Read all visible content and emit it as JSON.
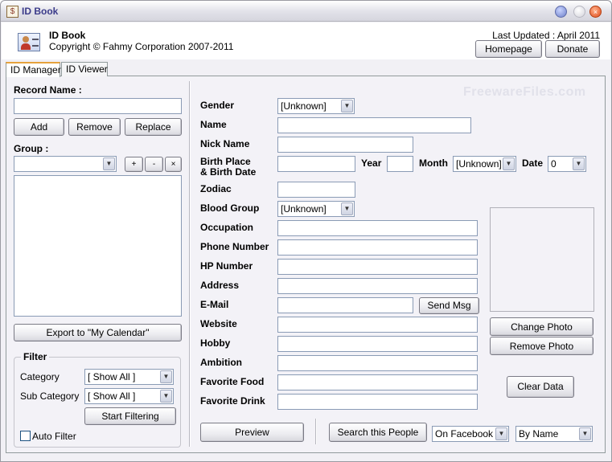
{
  "window": {
    "title": "ID Book"
  },
  "header": {
    "app_name": "ID Book",
    "copyright": "Copyright © Fahmy Corporation 2007-2011",
    "last_updated": "Last Updated : April 2011",
    "homepage_label": "Homepage",
    "donate_label": "Donate"
  },
  "tabs": [
    {
      "label": "ID Manager",
      "active": true
    },
    {
      "label": "ID Viewer",
      "active": false
    }
  ],
  "left": {
    "record_name_label": "Record Name :",
    "record_name_value": "",
    "add_label": "Add",
    "remove_label": "Remove",
    "replace_label": "Replace",
    "group_label": "Group :",
    "group_value": "",
    "group_plus": "+",
    "group_minus": "-",
    "group_x": "×",
    "export_label": "Export to \"My Calendar\"",
    "filter": {
      "title": "Filter",
      "category_label": "Category",
      "category_value": "[ Show All ]",
      "subcategory_label": "Sub Category",
      "subcategory_value": "[ Show All ]",
      "start_label": "Start Filtering",
      "auto_filter_label": "Auto Filter",
      "auto_filter_checked": false
    }
  },
  "form": {
    "watermark": "FreewareFiles.com",
    "gender_label": "Gender",
    "gender_value": "[Unknown]",
    "name_label": "Name",
    "name_value": "",
    "nick_label": "Nick Name",
    "nick_value": "",
    "birth_place_label_1": "Birth Place",
    "birth_place_label_2": "& Birth Date",
    "birth_place_value": "",
    "year_label": "Year",
    "year_value": "",
    "month_label": "Month",
    "month_value": "[Unknown]",
    "date_label": "Date",
    "date_value": "0",
    "zodiac_label": "Zodiac",
    "zodiac_value": "",
    "blood_label": "Blood Group",
    "blood_value": "[Unknown]",
    "occupation_label": "Occupation",
    "occupation_value": "",
    "phone_label": "Phone Number",
    "phone_value": "",
    "hp_label": "HP Number",
    "hp_value": "",
    "address_label": "Address",
    "address_value": "",
    "email_label": "E-Mail",
    "email_value": "",
    "send_msg_label": "Send Msg",
    "website_label": "Website",
    "website_value": "",
    "hobby_label": "Hobby",
    "hobby_value": "",
    "ambition_label": "Ambition",
    "ambition_value": "",
    "food_label": "Favorite Food",
    "food_value": "",
    "drink_label": "Favorite Drink",
    "drink_value": "",
    "change_photo_label": "Change Photo",
    "remove_photo_label": "Remove Photo",
    "clear_data_label": "Clear Data"
  },
  "bottom": {
    "preview_label": "Preview",
    "search_label": "Search this People",
    "search_where_value": "On Facebook",
    "search_by_value": "By Name"
  },
  "icons": {
    "dropdown_arrow": "▼"
  }
}
